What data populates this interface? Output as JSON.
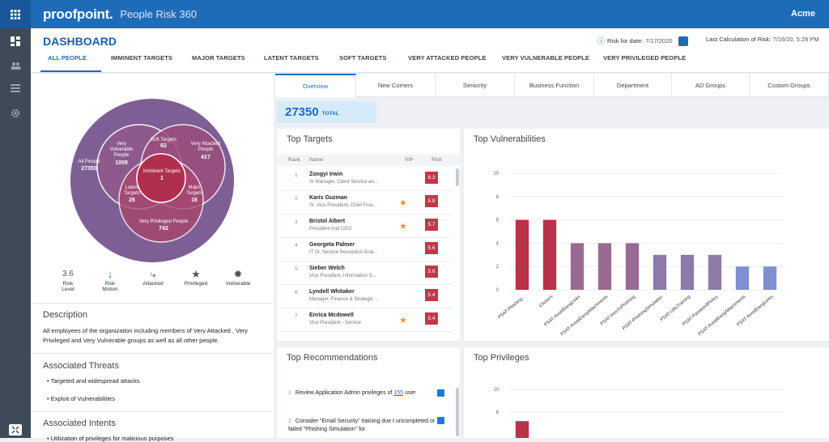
{
  "app": {
    "brand": "proofpoint.",
    "product": "People Risk 360",
    "tenant": "Acme"
  },
  "header": {
    "title": "DASHBOARD",
    "risk_for_date_label": "Risk for date:",
    "risk_for_date_value": "7/17/2020",
    "last_calc_label": "Last Calculation of Risk:",
    "last_calc_value": "7/16/20, 5:28 PM"
  },
  "nav_tabs": [
    "ALL PEOPLE",
    "IMMINENT TARGETS",
    "MAJOR TARGETS",
    "LATENT TARGETS",
    "SOFT TARGETS",
    "VERY ATTACKED PEOPLE",
    "VERY VULNERABLE PEOPLE",
    "VERY PRIVILEGED PEOPLE"
  ],
  "venn": {
    "all_people_label": "All People",
    "all_people_count": "27350",
    "very_vulnerable_label": "Very Vulnerable People",
    "very_vulnerable_count": "1009",
    "soft_targets_label": "Soft Targets",
    "soft_targets_count": "62",
    "very_attacked_label": "Very Attacked People",
    "very_attacked_count": "417",
    "imminent_label": "Imminent Targets",
    "imminent_count": "1",
    "latent_label": "Latent Targets",
    "latent_count": "26",
    "major_label": "Major Targets",
    "major_count": "16",
    "very_privileged_label": "Very Privileged People",
    "very_privileged_count": "742"
  },
  "risk_icons": {
    "risk_level_value": "3.6",
    "risk_level_label": "Risk Level",
    "risk_motion_label": "Risk Motion",
    "attacked_label": "Attacked",
    "privileged_label": "Privileged",
    "vulnerable_label": "Vulnerable"
  },
  "description": {
    "heading": "Description",
    "text": "All employees of the organization including members of Very Attacked , Very Privileged and Very Vulnerable groups as well as all other people."
  },
  "threats": {
    "heading": "Associated Threats",
    "items": [
      "Targeted and widespread attacks",
      "Exploit of Vulnerabilities"
    ]
  },
  "intents": {
    "heading": "Associated Intents",
    "items": [
      "Utilization of privileges for malicious purposes"
    ]
  },
  "sub_tabs": [
    "Overview",
    "New Comers",
    "Seniority",
    "Business Function",
    "Department",
    "AD Groups",
    "Custom Groups"
  ],
  "total": {
    "value": "27350",
    "label": "TOTAL"
  },
  "top_targets": {
    "title": "Top Targets",
    "columns": [
      "Rank",
      "Name",
      "VIP",
      "Risk"
    ],
    "rows": [
      {
        "rank": "1",
        "name": "Zongyi Irwin",
        "title": "Sr Manager, Client Service an...",
        "vip": false,
        "risk": "6.3"
      },
      {
        "rank": "2",
        "name": "Karis Guzman",
        "title": "Sr. Vice President, Chief Fina...",
        "vip": true,
        "risk": "5.8"
      },
      {
        "rank": "3",
        "name": "Bristol Albert",
        "title": "President And CEO",
        "vip": true,
        "risk": "5.7"
      },
      {
        "rank": "4",
        "name": "Georgeta Palmer",
        "title": "IT Sr. Service Resolution Anal...",
        "vip": false,
        "risk": "5.6"
      },
      {
        "rank": "5",
        "name": "Sieber Welch",
        "title": "Vice President, Information S...",
        "vip": false,
        "risk": "5.6"
      },
      {
        "rank": "6",
        "name": "Lyndell Whitaker",
        "title": "Manager, Finance & Strategic ...",
        "vip": false,
        "risk": "5.4"
      },
      {
        "rank": "7",
        "name": "Enrica Mcdowell",
        "title": "Vice President - Service",
        "vip": true,
        "risk": "5.4"
      }
    ]
  },
  "top_recommendations": {
    "title": "Top Recommendations",
    "items": [
      {
        "num": "1",
        "pre": "Review Application Admin privileges of",
        "link": "155",
        "post": "user"
      },
      {
        "num": "2",
        "pre": "Consider \"Email Security\" training due t uncompleted or failed \"Phishing Simulation\" for",
        "link": "",
        "post": ""
      }
    ]
  },
  "top_vulnerabilities": {
    "title": "Top Vulnerabilities"
  },
  "top_privileges": {
    "title": "Top Privileges"
  },
  "chart_data": [
    {
      "type": "bar",
      "title": "Top Vulnerabilities",
      "categories": [
        "PSAT-Phishing...",
        "Clickers",
        "PSAT-AvoidDangLinks",
        "PSAT-AvoidDangAttachments",
        "PSAT-IntroToPhishing",
        "PSAT-PhishingSimulation",
        "PSAT-URLTraining",
        "PSAT-PasswordPolicy",
        "PSAT-AvoidDangAttachments",
        "PSAT-AvoidDangLinks"
      ],
      "values": [
        6,
        6,
        4,
        4,
        4,
        3,
        3,
        3,
        2,
        2
      ],
      "colors": [
        "#b8334a",
        "#b8334a",
        "#9a6a93",
        "#9a6a93",
        "#9a6a93",
        "#8d7aa8",
        "#8d7aa8",
        "#8d7aa8",
        "#7f8fd0",
        "#7f8fd0"
      ],
      "yticks": [
        "0",
        "2",
        "4",
        "6",
        "8",
        "10"
      ],
      "ylim": [
        0,
        10
      ]
    },
    {
      "type": "bar",
      "title": "Top Privileges",
      "categories": [],
      "values": [],
      "yticks": [
        "8",
        "10"
      ],
      "ylim": [
        0,
        10
      ]
    }
  ]
}
